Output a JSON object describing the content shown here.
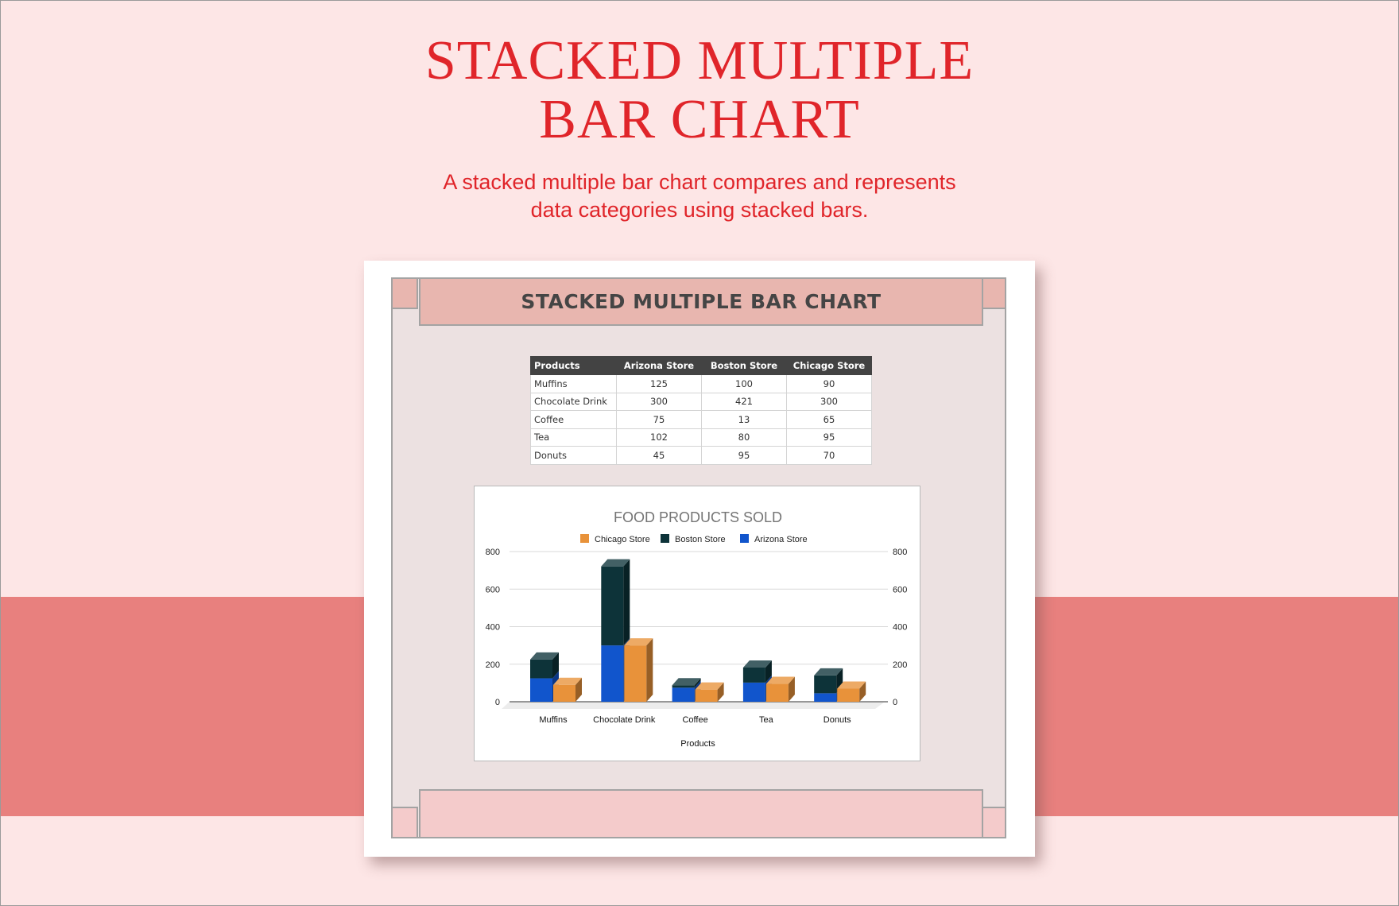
{
  "page": {
    "title_line1": "STACKED MULTIPLE",
    "title_line2": "BAR CHART",
    "subtitle_line1": "A stacked multiple bar chart compares and represents",
    "subtitle_line2": "data categories using stacked bars.",
    "colors": {
      "background": "#fde6e6",
      "band": "#e8807e",
      "title": "#e0252a",
      "header_band": "#e8b6af",
      "footer_band": "#f4cbcb"
    }
  },
  "card": {
    "header": "STACKED MULTIPLE BAR CHART"
  },
  "table": {
    "columns": [
      "Products",
      "Arizona Store",
      "Boston Store",
      "Chicago Store"
    ],
    "rows": [
      [
        "Muffins",
        "125",
        "100",
        "90"
      ],
      [
        "Chocolate Drink",
        "300",
        "421",
        "300"
      ],
      [
        "Coffee",
        "75",
        "13",
        "65"
      ],
      [
        "Tea",
        "102",
        "80",
        "95"
      ],
      [
        "Donuts",
        "45",
        "95",
        "70"
      ]
    ]
  },
  "chart_data": {
    "type": "bar",
    "subtype": "stacked-3d",
    "title": "FOOD PRODUCTS SOLD",
    "xlabel": "Products",
    "ylabel": "",
    "categories": [
      "Muffins",
      "Chocolate Drink",
      "Coffee",
      "Tea",
      "Donuts"
    ],
    "series": [
      {
        "name": "Arizona Store",
        "stack": "A",
        "color": "#1155cc",
        "values": [
          125,
          300,
          75,
          102,
          45
        ]
      },
      {
        "name": "Boston Store",
        "stack": "A",
        "color": "#0d3339",
        "values": [
          100,
          421,
          13,
          80,
          95
        ]
      },
      {
        "name": "Chicago Store",
        "stack": "B",
        "color": "#e8923a",
        "values": [
          90,
          300,
          65,
          95,
          70
        ]
      }
    ],
    "legend": [
      "Chicago Store",
      "Boston Store",
      "Arizona Store"
    ],
    "legend_position": "top",
    "yticks": [
      0,
      200,
      400,
      600,
      800
    ],
    "ylim": [
      0,
      800
    ],
    "y_axis_both_sides": true,
    "grid": true
  }
}
